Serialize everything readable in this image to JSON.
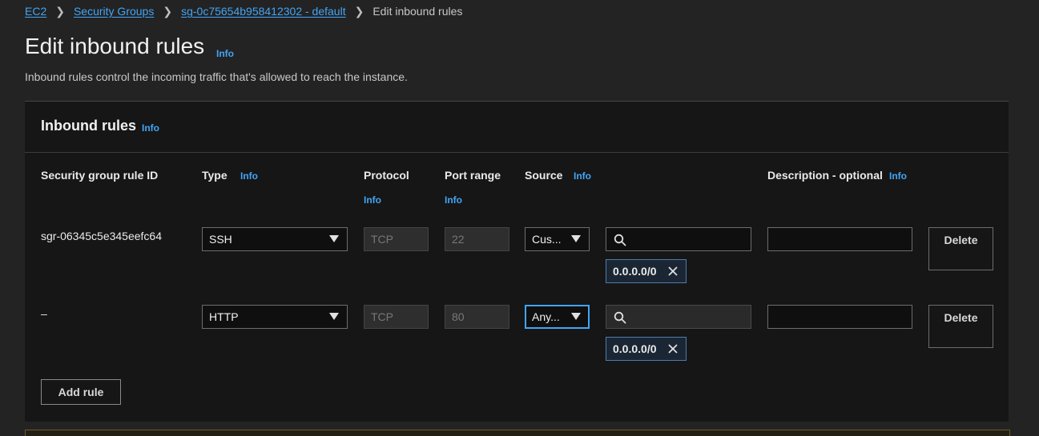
{
  "breadcrumb": {
    "items": [
      "EC2",
      "Security Groups",
      "sg-0c75654b958412302 - default"
    ],
    "current": "Edit inbound rules"
  },
  "header": {
    "title": "Edit inbound rules",
    "info": "Info",
    "subtitle": "Inbound rules control the incoming traffic that's allowed to reach the instance."
  },
  "panel": {
    "title": "Inbound rules",
    "info": "Info",
    "columns": {
      "rule_id": "Security group rule ID",
      "type": "Type",
      "protocol": "Protocol",
      "port_range": "Port range",
      "source": "Source",
      "description": "Description - optional",
      "info": "Info"
    },
    "rows": [
      {
        "rule_id": "sgr-06345c5e345eefc64",
        "type": "SSH",
        "protocol": "TCP",
        "port_range": "22",
        "source": "Cus...",
        "search_value": "",
        "cidr": "0.0.0.0/0",
        "description": "",
        "delete_label": "Delete"
      },
      {
        "rule_id": "–",
        "type": "HTTP",
        "protocol": "TCP",
        "port_range": "80",
        "source": "Any...",
        "search_value": "",
        "cidr": "0.0.0.0/0",
        "description": "",
        "delete_label": "Delete"
      }
    ],
    "add_rule_label": "Add rule"
  },
  "colors": {
    "background": "#232323",
    "panel": "#161616",
    "link": "#42a5f5",
    "focus": "#42a5f5"
  }
}
